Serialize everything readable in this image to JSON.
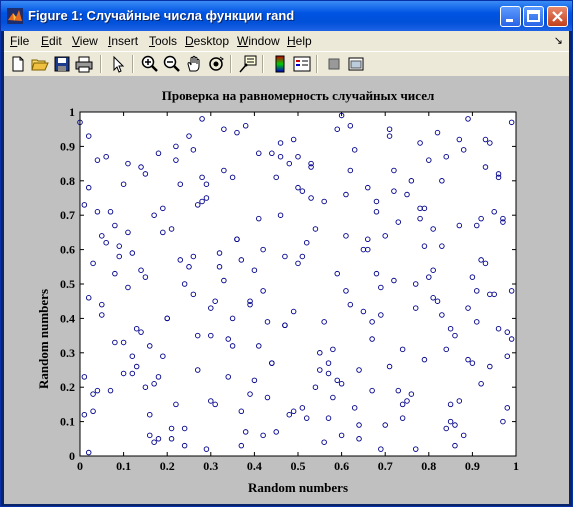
{
  "window": {
    "title": "Figure 1: Случайные числа функции rand",
    "controls": [
      "minimize",
      "maximize",
      "close"
    ]
  },
  "menubar": {
    "items": [
      {
        "label": "File",
        "key": "F",
        "rest": "ile"
      },
      {
        "label": "Edit",
        "key": "E",
        "rest": "dit"
      },
      {
        "label": "View",
        "key": "V",
        "rest": "iew"
      },
      {
        "label": "Insert",
        "key": "I",
        "rest": "nsert"
      },
      {
        "label": "Tools",
        "key": "T",
        "rest": "ools"
      },
      {
        "label": "Desktop",
        "key": "D",
        "rest": "esktop"
      },
      {
        "label": "Window",
        "key": "W",
        "rest": "indow"
      },
      {
        "label": "Help",
        "key": "H",
        "rest": "elp"
      }
    ],
    "arrow": "↘"
  },
  "toolbar": {
    "tools": [
      "new-file-icon",
      "open-folder-icon",
      "save-icon",
      "print-icon",
      "select-arrow-icon",
      "zoom-in-icon",
      "zoom-out-icon",
      "pan-hand-icon",
      "rotate-3d-icon",
      "data-cursor-icon",
      "colorbar-icon",
      "legend-icon",
      "hide-tools-icon",
      "show-tools-icon"
    ]
  },
  "colors": {
    "marker": "#00008b",
    "figure_bg": "#c0c0c0",
    "axes_bg": "#ffffff"
  },
  "chart_data": {
    "type": "scatter",
    "title": "Проверка на равномерность случайных чисел",
    "xlabel": "Random numbers",
    "ylabel": "Random numbers",
    "xlim": [
      0,
      1
    ],
    "ylim": [
      0,
      1
    ],
    "xticks": [
      "0",
      "0.1",
      "0.2",
      "0.3",
      "0.4",
      "0.5",
      "0.6",
      "0.7",
      "0.8",
      "0.9",
      "1"
    ],
    "yticks": [
      "0",
      "0.1",
      "0.2",
      "0.3",
      "0.4",
      "0.5",
      "0.6",
      "0.7",
      "0.8",
      "0.9",
      "1"
    ],
    "marker": "o",
    "grid": false,
    "x": [
      0.01,
      0.02,
      0.04,
      0.05,
      0.08,
      0.1,
      0.12,
      0.15,
      0.16,
      0.18,
      0.21,
      0.22,
      0.26,
      0.28,
      0.3,
      0.32,
      0.35,
      0.37,
      0.39,
      0.41,
      0.44,
      0.46,
      0.49,
      0.51,
      0.53,
      0.56,
      0.59,
      0.61,
      0.64,
      0.66,
      0.69,
      0.71,
      0.74,
      0.76,
      0.79,
      0.81,
      0.84,
      0.86,
      0.89,
      0.91,
      0.94,
      0.96,
      0.98,
      0.99,
      0.03,
      0.07,
      0.11,
      0.14,
      0.19,
      0.24,
      0.27,
      0.33,
      0.36,
      0.43,
      0.47,
      0.52,
      0.57,
      0.62,
      0.67,
      0.72,
      0.77,
      0.82,
      0.87,
      0.92,
      0.97,
      0.06,
      0.13,
      0.17,
      0.23,
      0.29,
      0.34,
      0.38,
      0.42,
      0.48,
      0.54,
      0.58,
      0.63,
      0.68,
      0.73,
      0.78,
      0.83,
      0.88,
      0.93,
      0.98,
      0.02,
      0.09,
      0.16,
      0.25,
      0.31,
      0.4,
      0.45,
      0.5,
      0.55,
      0.6,
      0.65,
      0.7,
      0.75,
      0.8,
      0.85,
      0.9,
      0.95,
      0.01,
      0.12,
      0.2,
      0.28,
      0.37,
      0.44,
      0.53,
      0.61,
      0.69,
      0.78,
      0.86,
      0.94,
      0.05,
      0.15,
      0.22,
      0.3,
      0.39,
      0.47,
      0.56,
      0.64,
      0.72,
      0.81,
      0.89,
      0.97,
      0.08,
      0.18,
      0.26,
      0.35,
      0.42,
      0.51,
      0.59,
      0.67,
      0.75,
      0.84,
      0.92,
      0.99,
      0.04,
      0.11,
      0.19,
      0.27,
      0.36,
      0.46,
      0.52,
      0.62,
      0.71,
      0.79,
      0.87,
      0.96,
      0.03,
      0.14,
      0.21,
      0.32,
      0.41,
      0.49,
      0.57,
      0.66,
      0.74,
      0.83,
      0.91,
      0.0,
      0.1,
      0.17,
      0.24,
      0.33,
      0.43,
      0.5,
      0.6,
      0.68,
      0.77,
      0.85,
      0.93,
      0.06,
      0.13,
      0.23,
      0.31,
      0.38,
      0.48,
      0.55,
      0.63,
      0.73,
      0.8,
      0.88,
      0.98,
      0.02,
      0.09,
      0.2,
      0.29,
      0.4,
      0.45,
      0.58,
      0.65,
      0.7,
      0.82,
      0.9,
      0.95,
      0.07,
      0.16,
      0.25,
      0.34,
      0.44,
      0.54,
      0.61,
      0.69,
      0.76,
      0.86,
      0.94,
      0.01,
      0.12,
      0.22,
      0.3,
      0.37,
      0.47,
      0.53,
      0.64,
      0.72,
      0.81,
      0.89,
      0.97,
      0.05,
      0.15,
      0.27,
      0.36,
      0.42,
      0.51,
      0.59,
      0.67,
      0.78,
      0.84,
      0.92,
      0.99,
      0.03,
      0.11,
      0.18,
      0.26,
      0.35,
      0.46,
      0.56,
      0.62,
      0.71,
      0.79,
      0.87,
      0.96,
      0.04,
      0.14,
      0.21,
      0.28,
      0.39,
      0.49,
      0.57,
      0.66,
      0.74,
      0.83,
      0.91,
      0.08,
      0.17,
      0.24,
      0.33,
      0.41,
      0.5,
      0.6,
      0.68,
      0.77,
      0.85,
      0.93,
      0.02,
      0.1,
      0.19,
      0.29,
      0.38,
      0.45,
      0.55,
      0.63,
      0.73,
      0.8,
      0.88,
      0.98
    ],
    "y": [
      0.12,
      0.93,
      0.71,
      0.41,
      0.33,
      0.79,
      0.24,
      0.52,
      0.06,
      0.88,
      0.66,
      0.15,
      0.47,
      0.98,
      0.35,
      0.59,
      0.81,
      0.03,
      0.44,
      0.69,
      0.27,
      0.91,
      0.13,
      0.58,
      0.85,
      0.39,
      0.22,
      0.76,
      0.05,
      0.63,
      0.49,
      0.95,
      0.31,
      0.18,
      0.72,
      0.54,
      0.87,
      0.09,
      0.43,
      0.67,
      0.26,
      0.82,
      0.14,
      0.97,
      0.56,
      0.19,
      0.65,
      0.84,
      0.29,
      0.08,
      0.73,
      0.51,
      0.94,
      0.17,
      0.38,
      0.62,
      0.11,
      0.83,
      0.34,
      0.77,
      0.02,
      0.45,
      0.92,
      0.21,
      0.68,
      0.87,
      0.37,
      0.04,
      0.57,
      0.79,
      0.23,
      0.96,
      0.48,
      0.12,
      0.66,
      0.31,
      0.89,
      0.53,
      0.19,
      0.72,
      0.41,
      0.06,
      0.84,
      0.29,
      0.46,
      0.61,
      0.32,
      0.93,
      0.15,
      0.54,
      0.07,
      0.78,
      0.25,
      0.99,
      0.42,
      0.64,
      0.16,
      0.86,
      0.37,
      0.52,
      0.71,
      0.23,
      0.59,
      0.4,
      0.81,
      0.13,
      0.27,
      0.75,
      0.48,
      0.02,
      0.69,
      0.35,
      0.91,
      0.64,
      0.2,
      0.86,
      0.43,
      0.18,
      0.58,
      0.74,
      0.09,
      0.83,
      0.46,
      0.28,
      0.69,
      0.53,
      0.05,
      0.89,
      0.32,
      0.6,
      0.14,
      0.95,
      0.39,
      0.76,
      0.08,
      0.57,
      0.34,
      0.19,
      0.49,
      0.72,
      0.25,
      0.63,
      0.87,
      0.11,
      0.44,
      0.93,
      0.28,
      0.67,
      0.81,
      0.18,
      0.36,
      0.05,
      0.55,
      0.88,
      0.42,
      0.24,
      0.78,
      0.15,
      0.61,
      0.48,
      0.97,
      0.33,
      0.7,
      0.03,
      0.83,
      0.39,
      0.56,
      0.21,
      0.74,
      0.5,
      0.1,
      0.92,
      0.62,
      0.26,
      0.79,
      0.45,
      0.07,
      0.85,
      0.3,
      0.14,
      0.68,
      0.52,
      0.89,
      0.36,
      0.01,
      0.58,
      0.4,
      0.75,
      0.22,
      0.81,
      0.17,
      0.6,
      0.09,
      0.94,
      0.27,
      0.47,
      0.71,
      0.12,
      0.55,
      0.34,
      0.88,
      0.2,
      0.64,
      0.41,
      0.8,
      0.03,
      0.47,
      0.73,
      0.29,
      0.9,
      0.16,
      0.57,
      0.38,
      0.84,
      0.25,
      0.51,
      0.66,
      0.98,
      0.1,
      0.44,
      0.82,
      0.35,
      0.63,
      0.06,
      0.77,
      0.53,
      0.19,
      0.91,
      0.31,
      0.69,
      0.48,
      0.13,
      0.85,
      0.23,
      0.58,
      0.4,
      0.7,
      0.04,
      0.96,
      0.26,
      0.61,
      0.16,
      0.37,
      0.86,
      0.54,
      0.08,
      0.74,
      0.45,
      0.92,
      0.27,
      0.6,
      0.11,
      0.8,
      0.39,
      0.67,
      0.21,
      0.5,
      0.95,
      0.32,
      0.87,
      0.06,
      0.71,
      0.43,
      0.15,
      0.56,
      0.78,
      0.24,
      0.65,
      0.02
    ]
  }
}
